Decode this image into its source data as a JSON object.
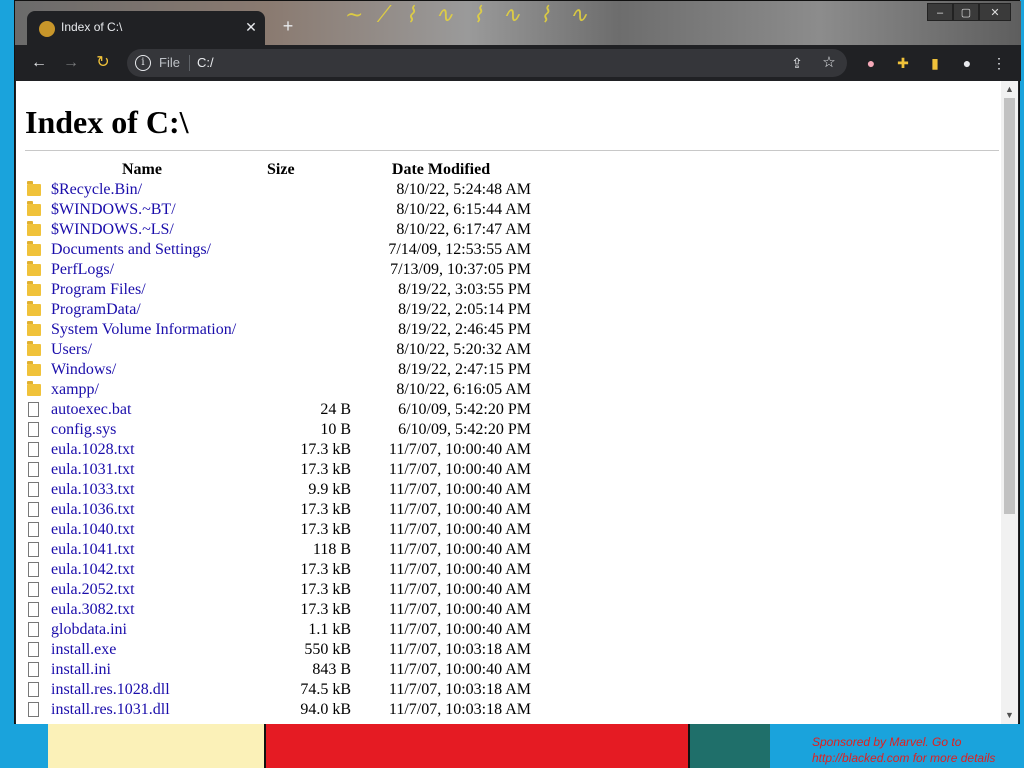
{
  "tab": {
    "title": "Index of C:\\"
  },
  "toolbar": {
    "file_label": "File",
    "url": "C:/"
  },
  "page": {
    "heading": "Index of C:\\",
    "columns": {
      "name": "Name",
      "size": "Size",
      "date": "Date Modified"
    },
    "rows": [
      {
        "type": "folder",
        "name": "$Recycle.Bin/",
        "size": "",
        "date": "8/10/22, 5:24:48 AM"
      },
      {
        "type": "folder",
        "name": "$WINDOWS.~BT/",
        "size": "",
        "date": "8/10/22, 6:15:44 AM"
      },
      {
        "type": "folder",
        "name": "$WINDOWS.~LS/",
        "size": "",
        "date": "8/10/22, 6:17:47 AM"
      },
      {
        "type": "folder",
        "name": "Documents and Settings/",
        "size": "",
        "date": "7/14/09, 12:53:55 AM"
      },
      {
        "type": "folder",
        "name": "PerfLogs/",
        "size": "",
        "date": "7/13/09, 10:37:05 PM"
      },
      {
        "type": "folder",
        "name": "Program Files/",
        "size": "",
        "date": "8/19/22, 3:03:55 PM"
      },
      {
        "type": "folder",
        "name": "ProgramData/",
        "size": "",
        "date": "8/19/22, 2:05:14 PM"
      },
      {
        "type": "folder",
        "name": "System Volume Information/",
        "size": "",
        "date": "8/19/22, 2:46:45 PM"
      },
      {
        "type": "folder",
        "name": "Users/",
        "size": "",
        "date": "8/10/22, 5:20:32 AM"
      },
      {
        "type": "folder",
        "name": "Windows/",
        "size": "",
        "date": "8/19/22, 2:47:15 PM"
      },
      {
        "type": "folder",
        "name": "xampp/",
        "size": "",
        "date": "8/10/22, 6:16:05 AM"
      },
      {
        "type": "file",
        "name": "autoexec.bat",
        "size": "24 B",
        "date": "6/10/09, 5:42:20 PM"
      },
      {
        "type": "file",
        "name": "config.sys",
        "size": "10 B",
        "date": "6/10/09, 5:42:20 PM"
      },
      {
        "type": "file",
        "name": "eula.1028.txt",
        "size": "17.3 kB",
        "date": "11/7/07, 10:00:40 AM"
      },
      {
        "type": "file",
        "name": "eula.1031.txt",
        "size": "17.3 kB",
        "date": "11/7/07, 10:00:40 AM"
      },
      {
        "type": "file",
        "name": "eula.1033.txt",
        "size": "9.9 kB",
        "date": "11/7/07, 10:00:40 AM"
      },
      {
        "type": "file",
        "name": "eula.1036.txt",
        "size": "17.3 kB",
        "date": "11/7/07, 10:00:40 AM"
      },
      {
        "type": "file",
        "name": "eula.1040.txt",
        "size": "17.3 kB",
        "date": "11/7/07, 10:00:40 AM"
      },
      {
        "type": "file",
        "name": "eula.1041.txt",
        "size": "118 B",
        "date": "11/7/07, 10:00:40 AM"
      },
      {
        "type": "file",
        "name": "eula.1042.txt",
        "size": "17.3 kB",
        "date": "11/7/07, 10:00:40 AM"
      },
      {
        "type": "file",
        "name": "eula.2052.txt",
        "size": "17.3 kB",
        "date": "11/7/07, 10:00:40 AM"
      },
      {
        "type": "file",
        "name": "eula.3082.txt",
        "size": "17.3 kB",
        "date": "11/7/07, 10:00:40 AM"
      },
      {
        "type": "file",
        "name": "globdata.ini",
        "size": "1.1 kB",
        "date": "11/7/07, 10:00:40 AM"
      },
      {
        "type": "file",
        "name": "install.exe",
        "size": "550 kB",
        "date": "11/7/07, 10:03:18 AM"
      },
      {
        "type": "file",
        "name": "install.ini",
        "size": "843 B",
        "date": "11/7/07, 10:00:40 AM"
      },
      {
        "type": "file",
        "name": "install.res.1028.dll",
        "size": "74.5 kB",
        "date": "11/7/07, 10:03:18 AM"
      },
      {
        "type": "file",
        "name": "install.res.1031.dll",
        "size": "94.0 kB",
        "date": "11/7/07, 10:03:18 AM"
      }
    ]
  },
  "desktop": {
    "sponsor_text": "Sponsored by Marvel. Go to http://blacked.com for more details"
  },
  "icons": {
    "back": "arrow-left-icon",
    "forward": "arrow-right-icon",
    "reload": "reload-icon",
    "info": "info-icon",
    "share": "share-icon",
    "star": "star-icon",
    "profile": "profile-icon",
    "extensions": "puzzle-icon",
    "menu": "kebab-menu-icon"
  },
  "colors": {
    "link": "#1a0dab",
    "toolbar": "#202124",
    "omnibox": "#35363a",
    "desktop": "#1aa3dc"
  }
}
